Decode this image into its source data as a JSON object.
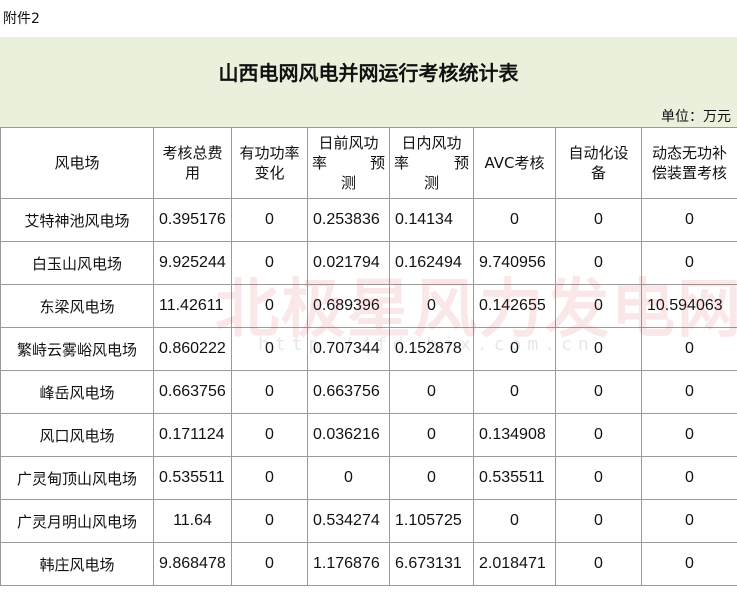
{
  "attachment_label": "附件2",
  "title": "山西电网风电并网运行考核统计表",
  "unit": "单位：万元",
  "headers": {
    "farm": "风电场",
    "total_a": "考核总费",
    "total_b": "用",
    "active_a": "有功功率",
    "active_b": "变化",
    "dayahead_a": "日前风功",
    "dayahead_b1": "率",
    "dayahead_b2": "预",
    "dayahead_c": "测",
    "intraday_a": "日内风功",
    "intraday_b1": "率",
    "intraday_b2": "预",
    "intraday_c": "测",
    "avc": "AVC考核",
    "auto_a": "自动化设",
    "auto_b": "备",
    "dyn_a": "动态无功补",
    "dyn_b": "偿装置考核"
  },
  "rows": [
    {
      "farm": "艾特神池风电场",
      "total": "0.395176",
      "active": "0",
      "dayahead": "0.253836",
      "intraday": "0.14134",
      "avc": "0",
      "auto": "0",
      "dyn": "0"
    },
    {
      "farm": "白玉山风电场",
      "total": "9.925244",
      "active": "0",
      "dayahead": "0.021794",
      "intraday": "0.162494",
      "avc": "9.740956",
      "auto": "0",
      "dyn": "0"
    },
    {
      "farm": "东梁风电场",
      "total": "11.42611",
      "active": "0",
      "dayahead": "0.689396",
      "intraday": "0",
      "avc": "0.142655",
      "auto": "0",
      "dyn": "10.594063"
    },
    {
      "farm": "繁峙云雾峪风电场",
      "total": "0.860222",
      "active": "0",
      "dayahead": "0.707344",
      "intraday": "0.152878",
      "avc": "0",
      "auto": "0",
      "dyn": "0"
    },
    {
      "farm": "峰岳风电场",
      "total": "0.663756",
      "active": "0",
      "dayahead": "0.663756",
      "intraday": "0",
      "avc": "0",
      "auto": "0",
      "dyn": "0"
    },
    {
      "farm": "风口风电场",
      "total": "0.171124",
      "active": "0",
      "dayahead": "0.036216",
      "intraday": "0",
      "avc": "0.134908",
      "auto": "0",
      "dyn": "0"
    },
    {
      "farm": "广灵甸顶山风电场",
      "total": "0.535511",
      "active": "0",
      "dayahead": "0",
      "intraday": "0",
      "avc": "0.535511",
      "auto": "0",
      "dyn": "0"
    },
    {
      "farm": "广灵月明山风电场",
      "total": "11.64",
      "active": "0",
      "dayahead": "0.534274",
      "intraday": "1.105725",
      "avc": "0",
      "auto": "0",
      "dyn": "0"
    },
    {
      "farm": "韩庄风电场",
      "total": "9.868478",
      "active": "0",
      "dayahead": "1.176876",
      "intraday": "6.673131",
      "avc": "2.018471",
      "auto": "0",
      "dyn": "0"
    }
  ],
  "watermark": {
    "text": "北极星风力发电网",
    "url": "http://fd.bjx.com.cn"
  }
}
